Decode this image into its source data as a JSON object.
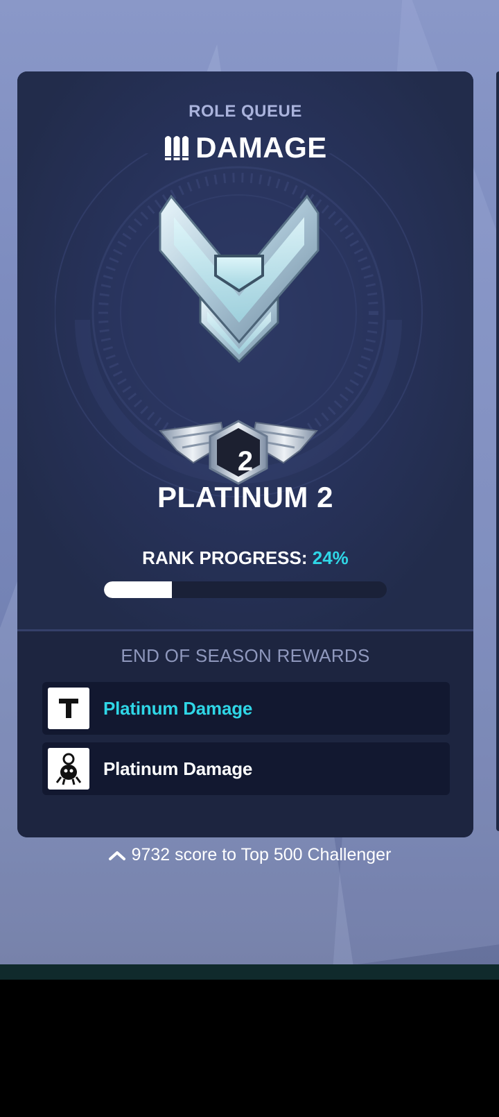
{
  "card": {
    "header": "ROLE QUEUE",
    "role": "DAMAGE",
    "role_icon": "damage-role-icon",
    "rank": "PLATINUM 2",
    "division_number": "2",
    "progress_label": "RANK PROGRESS:",
    "progress_value": "24%",
    "progress_fraction": 0.24
  },
  "rewards": {
    "title": "END OF SEASON REWARDS",
    "items": [
      {
        "label": "Platinum Damage",
        "icon": "title-icon"
      },
      {
        "label": "Platinum Damage",
        "icon": "spray-icon"
      }
    ]
  },
  "footer": {
    "text": "9732 score to Top 500 Challenger",
    "icon": "chevron-up-icon"
  },
  "colors": {
    "accent": "#2fd6e6",
    "card_bg": "#242e4d",
    "background": "#8a98c8"
  }
}
